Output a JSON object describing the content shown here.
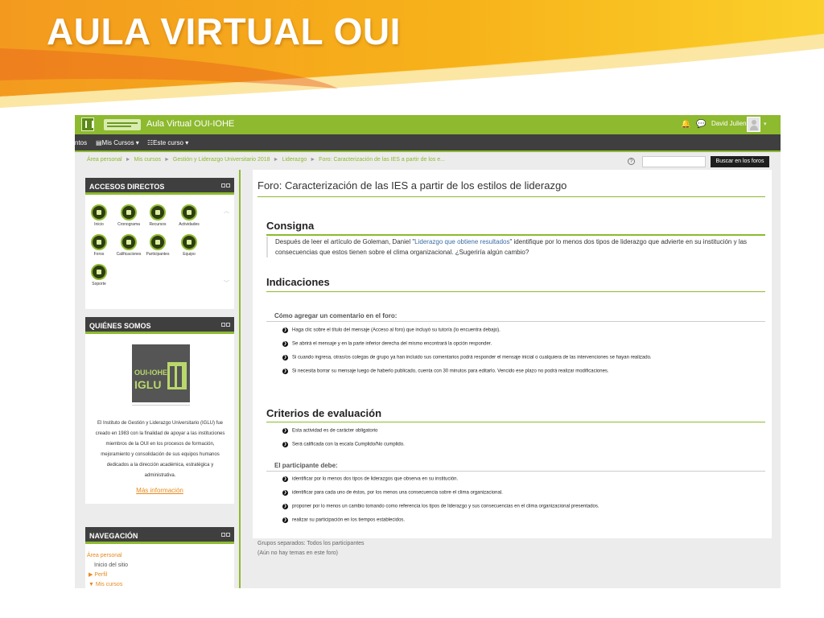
{
  "slide": {
    "title": "AULA VIRTUAL OUI",
    "banner_colors": [
      "#f39a1e",
      "#f8c31a",
      "#e8621c"
    ]
  },
  "topbar": {
    "site_title": "Aula Virtual OUI-IOHE",
    "bell_icon": "🔔",
    "chat_icon": "💬",
    "user_name": "David Julien",
    "caret": "▾",
    "accent_color": "#8dba2f"
  },
  "navbar": {
    "items": [
      {
        "label": "ntos"
      },
      {
        "label": "▤Mis Cursos ▾"
      },
      {
        "label": "☷Este curso ▾"
      }
    ]
  },
  "breadcrumb": {
    "items": [
      "Área personal",
      "Mis cursos",
      "Gestión y Liderazgo Universitario 2018",
      "Liderazgo",
      "Foro: Caracterización de las IES a partir de los e..."
    ],
    "separator": "►"
  },
  "search": {
    "placeholder": "",
    "button_label": "Buscar en los foros",
    "help": "?"
  },
  "accesos": {
    "title": "ACCESOS DIRECTOS",
    "icons": [
      {
        "label": "Inicio",
        "name": "home-icon"
      },
      {
        "label": "Cronograma",
        "name": "calendar-icon"
      },
      {
        "label": "Recursos",
        "name": "folder-icon"
      },
      {
        "label": "Actividades",
        "name": "pencil-icon"
      },
      {
        "label": "Foros",
        "name": "chat-bubble-icon"
      },
      {
        "label": "Calificaciones",
        "name": "check-icon"
      },
      {
        "label": "Participantes",
        "name": "graduation-cap-icon"
      },
      {
        "label": "Equipo",
        "name": "team-icon"
      },
      {
        "label": "Soporte",
        "name": "wrench-icon"
      }
    ],
    "scroll_up": "︿",
    "scroll_down": "﹀"
  },
  "quienes": {
    "title": "QUIÉNES SOMOS",
    "logo_line1": "OUI-IOHE",
    "logo_line2": "IGLU",
    "text": "El Instituto de Gestión y Liderazgo Universitario (IGLU) fue creado en 1983 con la finalidad de apoyar a las instituciones miembros de la OUI en los procesos de formación, mejoramiento y consolidación de sus equipos humanos dedicados a la dirección académica, estratégica y administrativa.",
    "more_link": "Más información"
  },
  "navegacion": {
    "title": "NAVEGACIÓN",
    "items": [
      "Área personal",
      "Inicio del sitio",
      "▶ Perfil",
      "▼ Mis cursos"
    ]
  },
  "forum": {
    "title": "Foro: Caracterización de las IES a partir de los estilos de liderazgo",
    "consigna_heading": "Consigna",
    "consigna_pre": "Después de leer el artículo de Goleman, Daniel \"",
    "consigna_link": "Liderazgo que obtiene resultados",
    "consigna_post": "\" identifique por lo menos dos tipos de liderazgo que advierte en su institución y las consecuencias que estos tienen sobre el clima organizacional. ¿Sugeriría algún cambio?",
    "indicaciones_heading": "Indicaciones",
    "como_heading": "Cómo agregar un comentario en el foro:",
    "como_items": [
      "Haga clic sobre el título del mensaje (Acceso al foro) que incluyó su tutor/a (lo encuentra debajo).",
      "Se abrirá el mensaje y en la parte inferior derecha del mismo encontrará la opción responder.",
      "Si cuando ingresa, otras/os colegas de grupo ya han incluido sus comentarios podrá responder el mensaje inicial o cualquiera de las intervenciones se hayan realizado.",
      "Si necesita borrar su mensaje luego de haberlo publicado, cuenta con 30 minutos para editarlo. Vencido ese plazo no podrá realizar modificaciones."
    ],
    "criterios_heading": "Criterios de evaluación",
    "criterios_items": [
      "Esta actividad es de carácter obligatorio",
      "Será calificada con la escala Cumplido/No cumplido."
    ],
    "participante_heading": "El participante debe:",
    "participante_items": [
      "identificar por lo menos dos tipos de liderazgos que observa en su institución.",
      "identificar para cada uno de éstos, por los menos una consecuencia sobre el clima organizacional.",
      "proponer por lo menos un cambio tomando como referencia los tipos de liderazgo y sus consecuencias en el clima organizacional presentados.",
      "realizar su participación en los tiempos establecidos."
    ],
    "bullet_glyph": "❯"
  },
  "footer": {
    "groups": "Grupos separados: Todos los participantes",
    "no_topics": "(Aún no hay temas en este foro)"
  }
}
